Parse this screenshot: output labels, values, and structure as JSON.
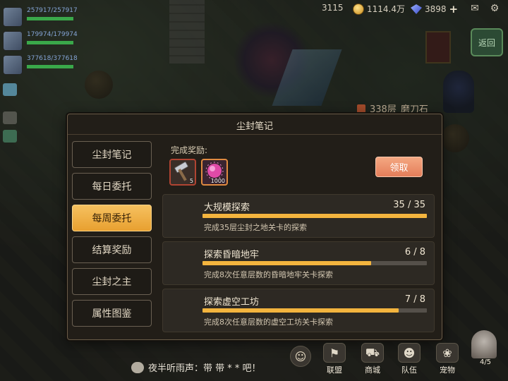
{
  "hud": {
    "res1_value": "3115",
    "gold_value": "1114.4万",
    "gem_value": "3898",
    "plus": "+",
    "back_label": "返回",
    "floor_text": "338层",
    "floor_extra": "磨刀石"
  },
  "players": [
    {
      "hp": "257917/257917",
      "fill": 1.0
    },
    {
      "hp": "179974/179974",
      "fill": 1.0
    },
    {
      "hp": "377618/377618",
      "fill": 1.0
    }
  ],
  "dialog": {
    "title": "尘封笔记",
    "tabs": [
      {
        "label": "尘封笔记",
        "active": false
      },
      {
        "label": "每日委托",
        "active": false
      },
      {
        "label": "每周委托",
        "active": true
      },
      {
        "label": "结算奖励",
        "active": false
      },
      {
        "label": "尘封之主",
        "active": false
      },
      {
        "label": "属性图鉴",
        "active": false
      }
    ],
    "reward_label": "完成奖励:",
    "rewards": [
      {
        "icon": "hammer-icon",
        "count": "5"
      },
      {
        "icon": "orb-icon",
        "count": "1000"
      }
    ],
    "claim_label": "领取",
    "tasks": [
      {
        "name": "大规模探索",
        "count": "35 / 35",
        "progress": 1.0,
        "desc": "完成35层尘封之地关卡的探索"
      },
      {
        "name": "探索昏暗地牢",
        "count": "6 / 8",
        "progress": 0.75,
        "desc": "完成8次任意层数的昏暗地牢关卡探索"
      },
      {
        "name": "探索虚空工坊",
        "count": "7 / 8",
        "progress": 0.875,
        "desc": "完成8次任意层数的虚空工坊关卡探索"
      }
    ]
  },
  "chat": {
    "text": "夜半听雨声：带 带 * * 吧！"
  },
  "bottom_nav": [
    {
      "label": "联盟",
      "icon": "alliance-icon"
    },
    {
      "label": "商城",
      "icon": "cart-icon"
    },
    {
      "label": "队伍",
      "icon": "team-icon"
    },
    {
      "label": "宠物",
      "icon": "paw-icon"
    }
  ],
  "ace": {
    "label": "4/5"
  },
  "colors": {
    "accent": "#f3b43e",
    "active_tab": "#e8a030",
    "claim_button": "#e47e5a",
    "panel_bg": "#221e18"
  }
}
